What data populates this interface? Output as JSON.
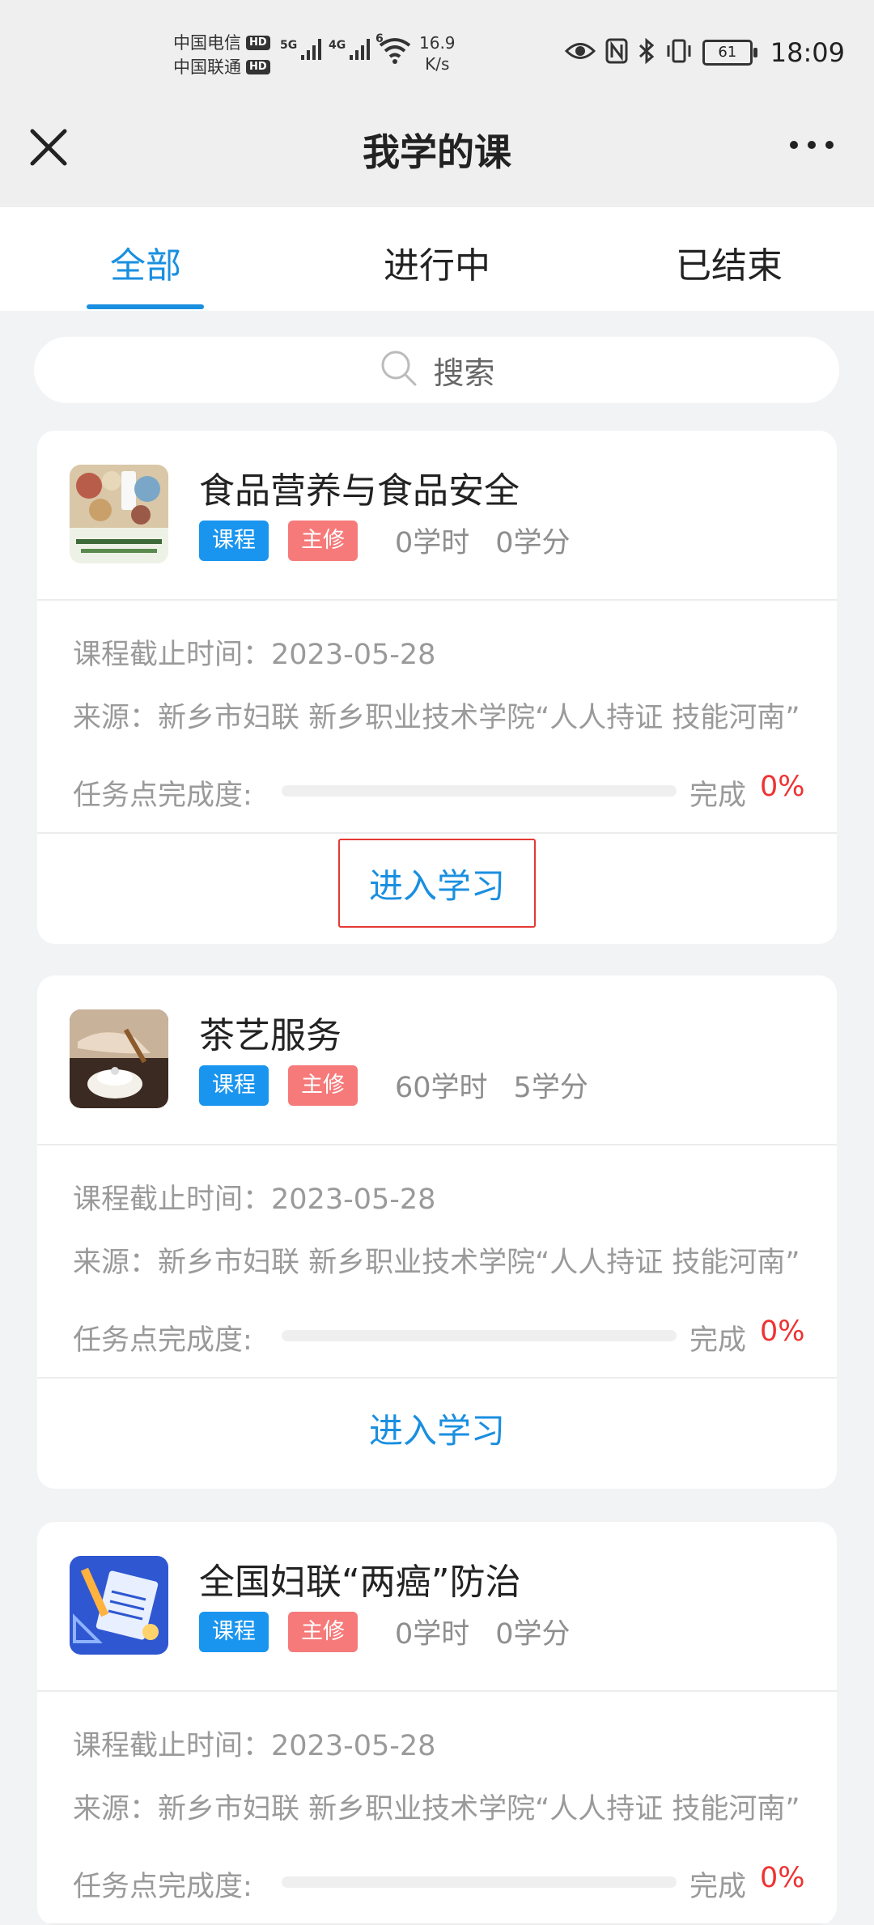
{
  "status_bar": {
    "carrier1": "中国电信",
    "carrier2": "中国联通",
    "hd": "HD",
    "net1": "5G",
    "net2": "4G",
    "wifi_label": "6",
    "speed_value": "16.9",
    "speed_unit": "K/s",
    "battery": "61",
    "time": "18:09"
  },
  "nav": {
    "title": "我学的课"
  },
  "tabs": [
    {
      "label": "全部",
      "active": true
    },
    {
      "label": "进行中",
      "active": false
    },
    {
      "label": "已结束",
      "active": false
    }
  ],
  "search": {
    "placeholder": "搜索"
  },
  "labels": {
    "deadline": "课程截止时间：",
    "source": "来源：",
    "progress": "任务点完成度:",
    "done": "完成",
    "enter": "进入学习"
  },
  "courses": [
    {
      "title": "食品营养与食品安全",
      "tag_type": "课程",
      "tag_req": "主修",
      "hours": "0学时",
      "credits": "0学分",
      "deadline": "2023-05-28",
      "source": "新乡市妇联 新乡职业技术学院“人人持证 技能河南”",
      "progress": "0%",
      "progress_fraction": 0,
      "thumb": "food-thumb"
    },
    {
      "title": "茶艺服务",
      "tag_type": "课程",
      "tag_req": "主修",
      "hours": "60学时",
      "credits": "5学分",
      "deadline": "2023-05-28",
      "source": "新乡市妇联 新乡职业技术学院“人人持证 技能河南”",
      "progress": "0%",
      "progress_fraction": 0,
      "thumb": "tea-thumb"
    },
    {
      "title": "全国妇联“两癌”防治",
      "tag_type": "课程",
      "tag_req": "主修",
      "hours": "0学时",
      "credits": "0学分",
      "deadline": "2023-05-28",
      "source": "新乡市妇联 新乡职业技术学院“人人持证 技能河南”",
      "progress": "0%",
      "progress_fraction": 0,
      "thumb": "blue-notebook-thumb"
    }
  ],
  "colors": {
    "accent": "#1a8fe0",
    "tag_blue": "#1a95ef",
    "tag_red": "#f67a7a",
    "percent_red": "#e33333",
    "highlight_border": "#e53935"
  }
}
